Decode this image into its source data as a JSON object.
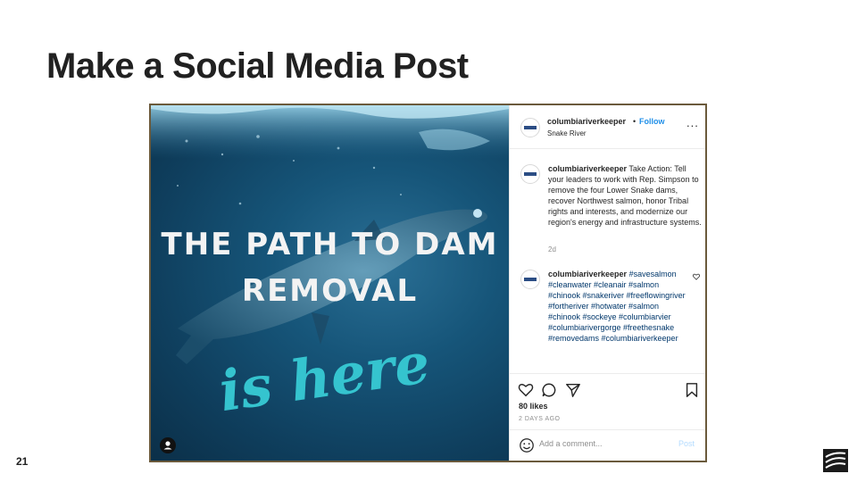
{
  "slide": {
    "title": "Make a Social Media Post",
    "page_number": "21"
  },
  "post": {
    "image_text": {
      "line1": "THE PATH TO DAM",
      "line2": "REMOVAL",
      "line3": "is here"
    },
    "header": {
      "username": "columbiariverkeeper",
      "separator": "•",
      "follow_label": "Follow",
      "location": "Snake River",
      "more_label": "..."
    },
    "caption": {
      "username": "columbiariverkeeper",
      "text": "Take Action: Tell your leaders to work with Rep. Simpson to remove the four Lower Snake dams, recover Northwest salmon, honor Tribal rights and interests, and modernize our region's energy and infrastructure systems.",
      "age": "2d"
    },
    "comment": {
      "username": "columbiariverkeeper",
      "text": "#savesalmon #cleanwater #cleanair #salmon #chinook #snakeriver #freeflowingriver #fortheriver #hotwater #salmon #chinook #sockeye #columbiarvier #columbiarivergorge #freethesnake #removedams #columbiariverkeeper"
    },
    "likes": "80 likes",
    "timestamp": "2 DAYS AGO",
    "add_comment_placeholder": "Add a comment...",
    "post_label": "Post"
  },
  "icons": {
    "like": "heart-icon",
    "comment": "comment-icon",
    "share": "share-icon",
    "save": "bookmark-icon",
    "emoji": "smiley-icon",
    "user": "user-tag-icon",
    "more": "more-options-icon"
  },
  "colors": {
    "accent_blue": "#1f8fe8",
    "hashtag": "#00376b",
    "script_text": "#35c4cf",
    "frame": "#6b5a3c"
  }
}
